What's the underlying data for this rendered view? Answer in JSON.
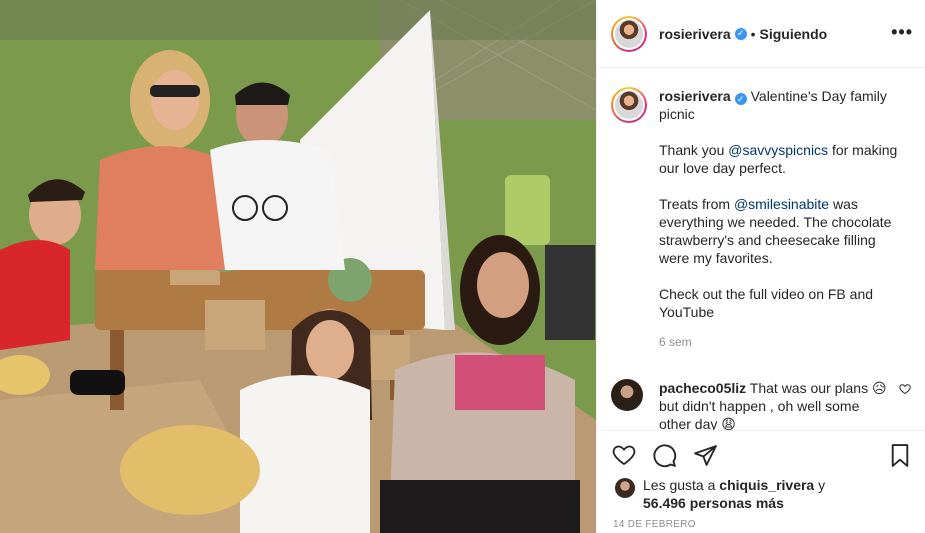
{
  "post": {
    "username": "rosierivera",
    "follow_status": "Siguiendo",
    "separator": "•"
  },
  "caption": {
    "username": "rosierivera",
    "line1": "Valentine's Day family picnic",
    "p2_pre": "Thank you ",
    "p2_mention": "@savvyspicnics",
    "p2_post": " for making our love day perfect.",
    "p3_pre": "Treats from ",
    "p3_mention": "@smilesinabite",
    "p3_post": " was everything we needed. The chocolate strawberry's and cheesecake filling were my favorites.",
    "p4": "Check out the full video on FB and YouTube",
    "time": "6 sem"
  },
  "comment": {
    "username": "pacheco05liz",
    "text_a": " That was our plans ",
    "emoji_a": "😥",
    "text_b": "but didn't happen , oh well some other day ",
    "emoji_b": "😩"
  },
  "likes": {
    "prefix": "Les gusta a ",
    "user": "chiquis_rivera",
    "connector": " y",
    "count_text": "56.496 personas más"
  },
  "date": "14 DE FEBRERO",
  "icons": {
    "like": "heart-icon",
    "comment": "comment-icon",
    "share": "send-icon",
    "save": "bookmark-icon",
    "more": "more-options-icon",
    "verified": "verified-badge-icon"
  },
  "colors": {
    "mention": "#00376b",
    "verified": "#3897f0",
    "muted": "#8e8e8e"
  }
}
